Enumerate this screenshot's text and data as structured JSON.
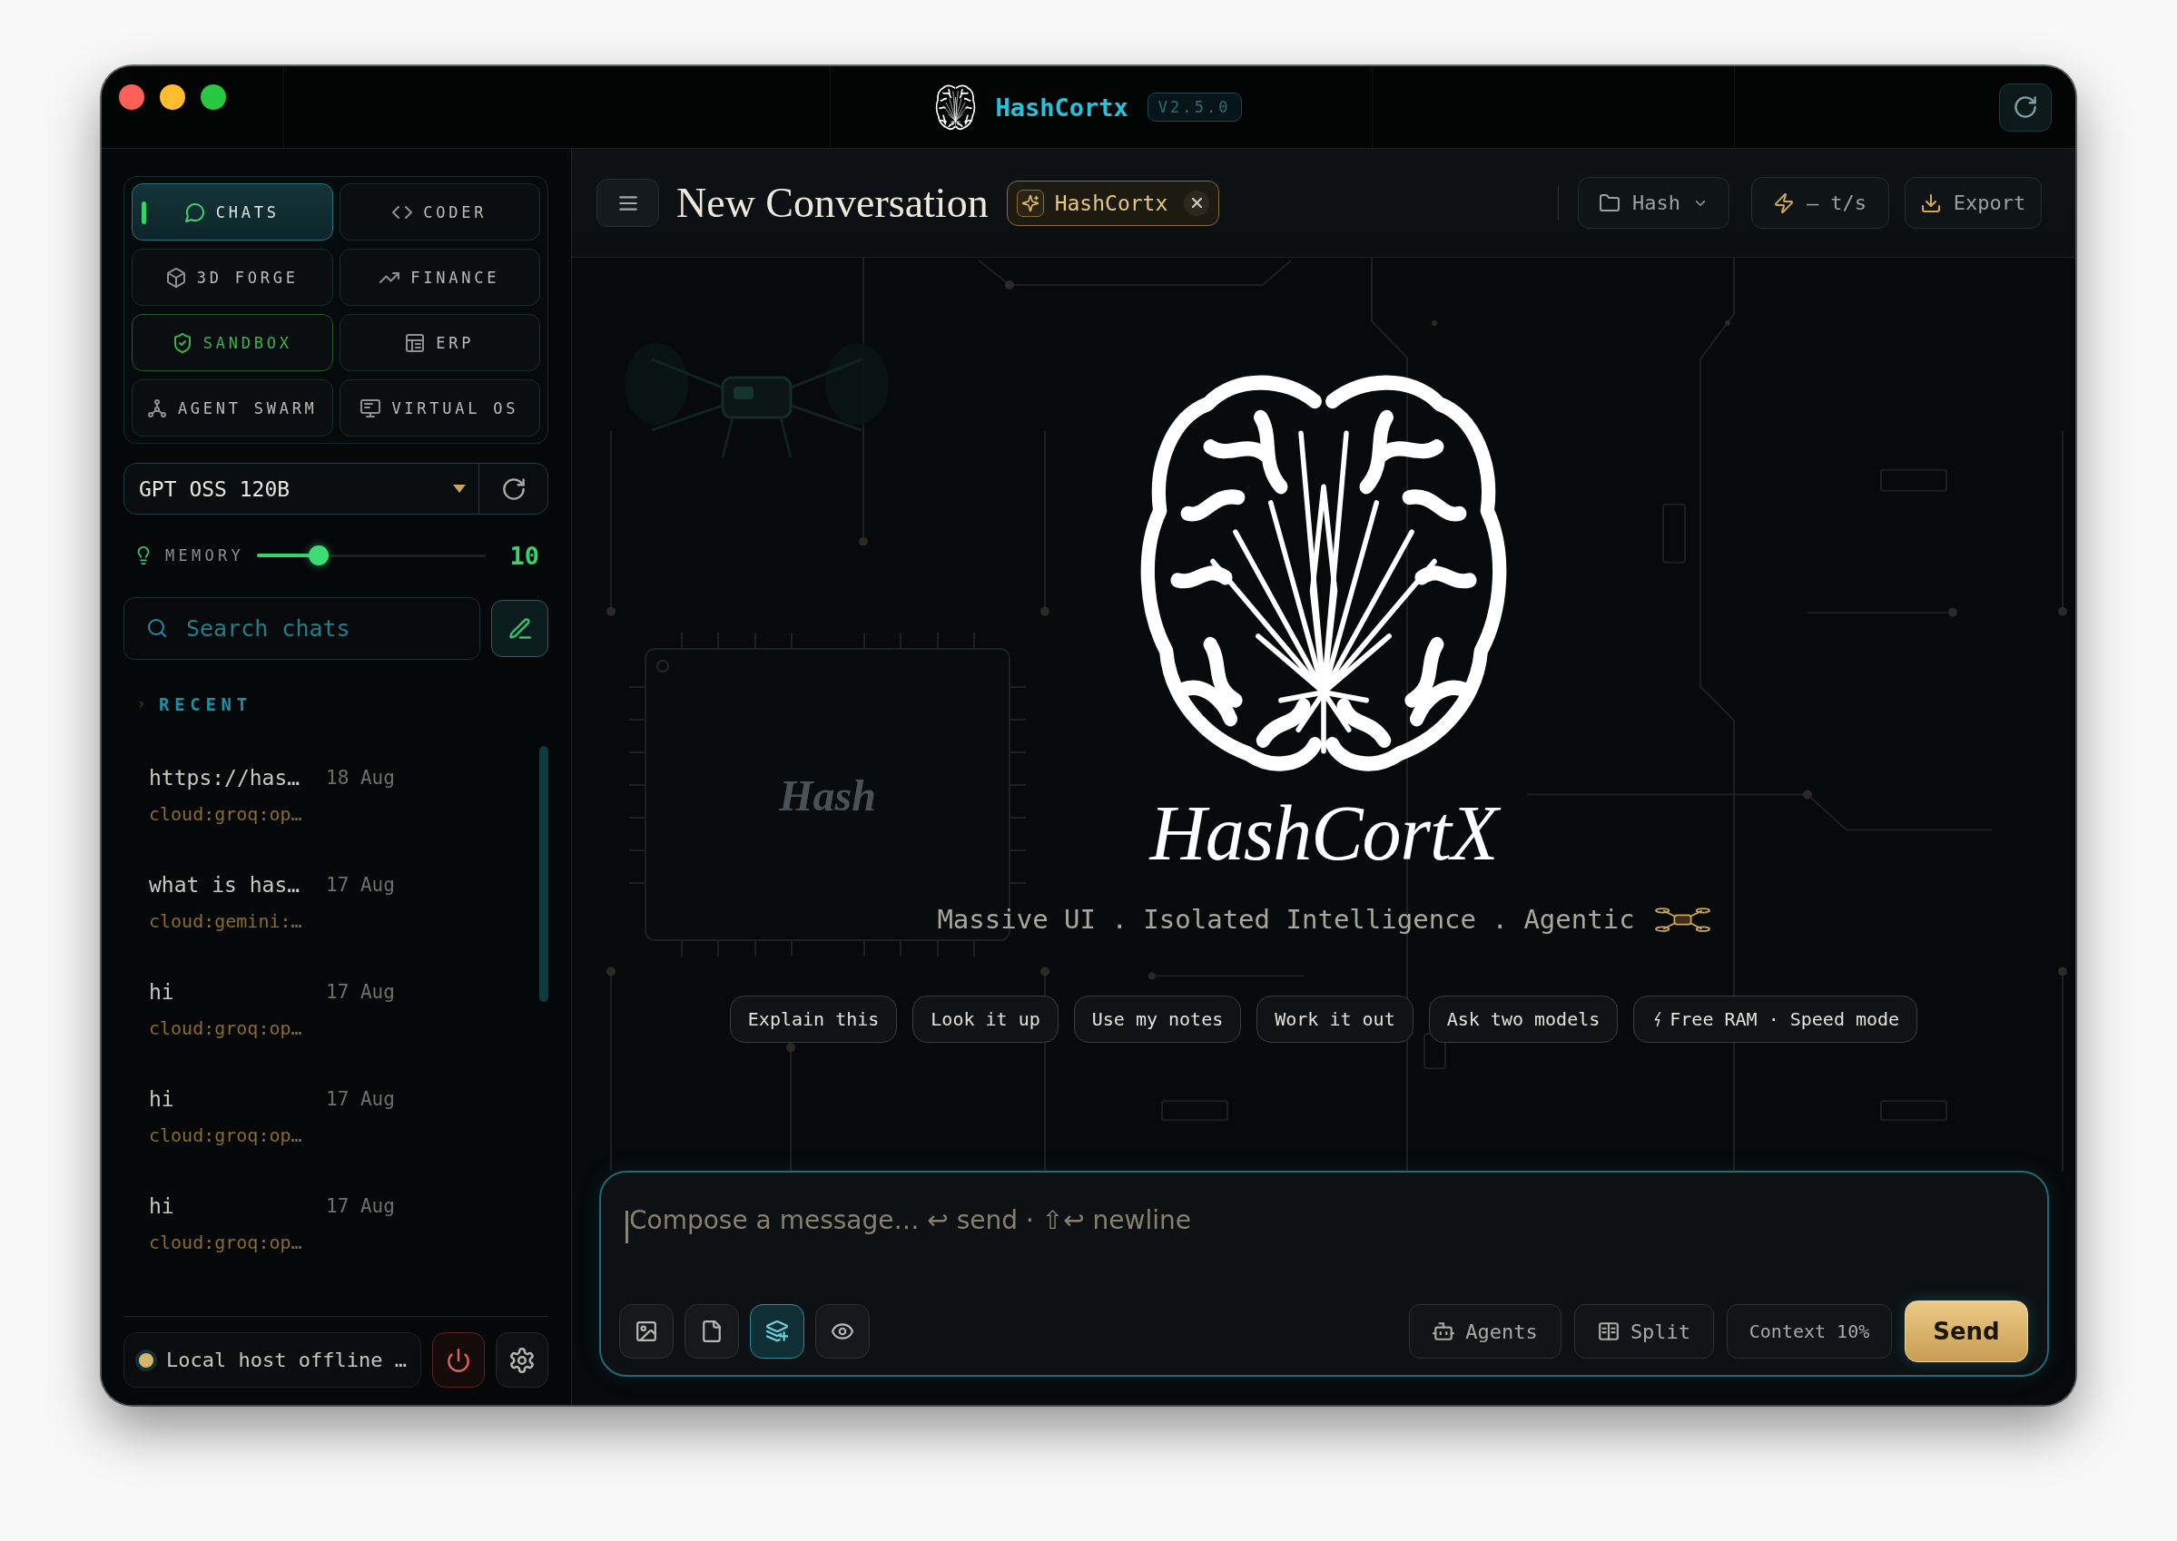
{
  "window": {
    "title": "HashCortx",
    "version": "V2.5.0"
  },
  "sidebar": {
    "modules": [
      {
        "label": "CHATS",
        "selected": true,
        "on": false
      },
      {
        "label": "CODER",
        "selected": false,
        "on": false
      },
      {
        "label": "3D FORGE",
        "selected": false,
        "on": false
      },
      {
        "label": "FINANCE",
        "selected": false,
        "on": false
      },
      {
        "label": "SANDBOX",
        "selected": false,
        "on": true
      },
      {
        "label": "ERP",
        "selected": false,
        "on": false
      },
      {
        "label": "AGENT SWARM",
        "selected": false,
        "on": false
      },
      {
        "label": "VIRTUAL OS",
        "selected": false,
        "on": false
      }
    ],
    "model_select": {
      "value": "GPT OSS 120B"
    },
    "memory": {
      "label": "MEMORY",
      "level": 0.27,
      "reading": "10"
    },
    "search": {
      "placeholder": "Search chats"
    },
    "recent": {
      "label": "RECENT",
      "chats": [
        {
          "title": "https://has…",
          "date": "18 Aug",
          "model": "cloud:groq:op…",
          "selected": false
        },
        {
          "title": "what is has…",
          "date": "17 Aug",
          "model": "cloud:gemini:…",
          "selected": false
        },
        {
          "title": "hi",
          "date": "17 Aug",
          "model": "cloud:groq:op…",
          "selected": false
        },
        {
          "title": "hi",
          "date": "17 Aug",
          "model": "cloud:groq:op…",
          "selected": false
        },
        {
          "title": "hi",
          "date": "17 Aug",
          "model": "cloud:groq:op…",
          "selected": false
        }
      ]
    },
    "status": {
      "text": "Local host offline …",
      "online": false
    }
  },
  "header": {
    "title": "New Conversation",
    "persona": "HashCortx",
    "folder": "Hash",
    "speed": "– t/s",
    "export": "Export"
  },
  "canvas": {
    "chip_label": "Hash",
    "wordmark": "HashCortX",
    "tagline": "Massive UI . Isolated Intelligence . Agentic",
    "suggestions": [
      {
        "label": "Explain this",
        "kind": "plain"
      },
      {
        "label": "Look it up",
        "kind": "plain"
      },
      {
        "label": "Use my notes",
        "kind": "plain"
      },
      {
        "label": "Work it out",
        "kind": "plain"
      },
      {
        "label": "Ask two models",
        "kind": "plain"
      },
      {
        "label": "Free RAM · Speed mode",
        "kind": "bolt"
      }
    ]
  },
  "composer": {
    "placeholder": "Compose a message… ↩ send · ⇧↩ newline",
    "focused": true,
    "tools": [
      {
        "on": false
      },
      {
        "on": false
      },
      {
        "on": true
      },
      {
        "on": false
      }
    ],
    "agents": "Agents",
    "split": "Split",
    "context": "Context 10%",
    "send": "Send"
  }
}
